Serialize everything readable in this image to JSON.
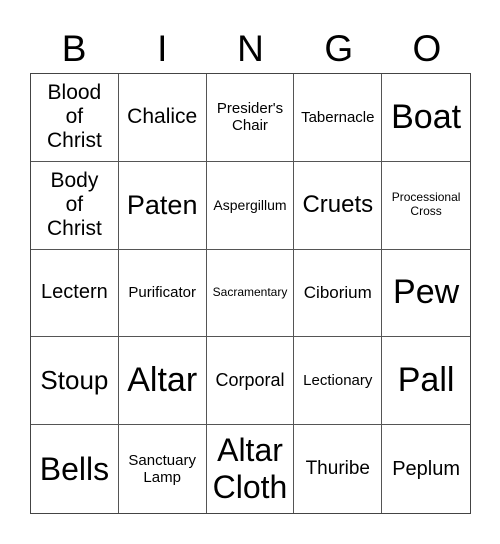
{
  "header": [
    "B",
    "I",
    "N",
    "G",
    "O"
  ],
  "cells": [
    {
      "text": "Blood\nof\nChrist",
      "size": 21
    },
    {
      "text": "Chalice",
      "size": 21
    },
    {
      "text": "Presider's\nChair",
      "size": 15
    },
    {
      "text": "Tabernacle",
      "size": 15
    },
    {
      "text": "Boat",
      "size": 34
    },
    {
      "text": "Body\nof\nChrist",
      "size": 21
    },
    {
      "text": "Paten",
      "size": 27
    },
    {
      "text": "Aspergillum",
      "size": 14
    },
    {
      "text": "Cruets",
      "size": 24
    },
    {
      "text": "Processional\nCross",
      "size": 12
    },
    {
      "text": "Lectern",
      "size": 20
    },
    {
      "text": "Purificator",
      "size": 15
    },
    {
      "text": "Sacramentary",
      "size": 12
    },
    {
      "text": "Ciborium",
      "size": 17
    },
    {
      "text": "Pew",
      "size": 34
    },
    {
      "text": "Stoup",
      "size": 26
    },
    {
      "text": "Altar",
      "size": 34
    },
    {
      "text": "Corporal",
      "size": 18
    },
    {
      "text": "Lectionary",
      "size": 15
    },
    {
      "text": "Pall",
      "size": 34
    },
    {
      "text": "Bells",
      "size": 32
    },
    {
      "text": "Sanctuary\nLamp",
      "size": 15
    },
    {
      "text": "Altar\nCloth",
      "size": 32
    },
    {
      "text": "Thuribe",
      "size": 19
    },
    {
      "text": "Peplum",
      "size": 20
    }
  ]
}
